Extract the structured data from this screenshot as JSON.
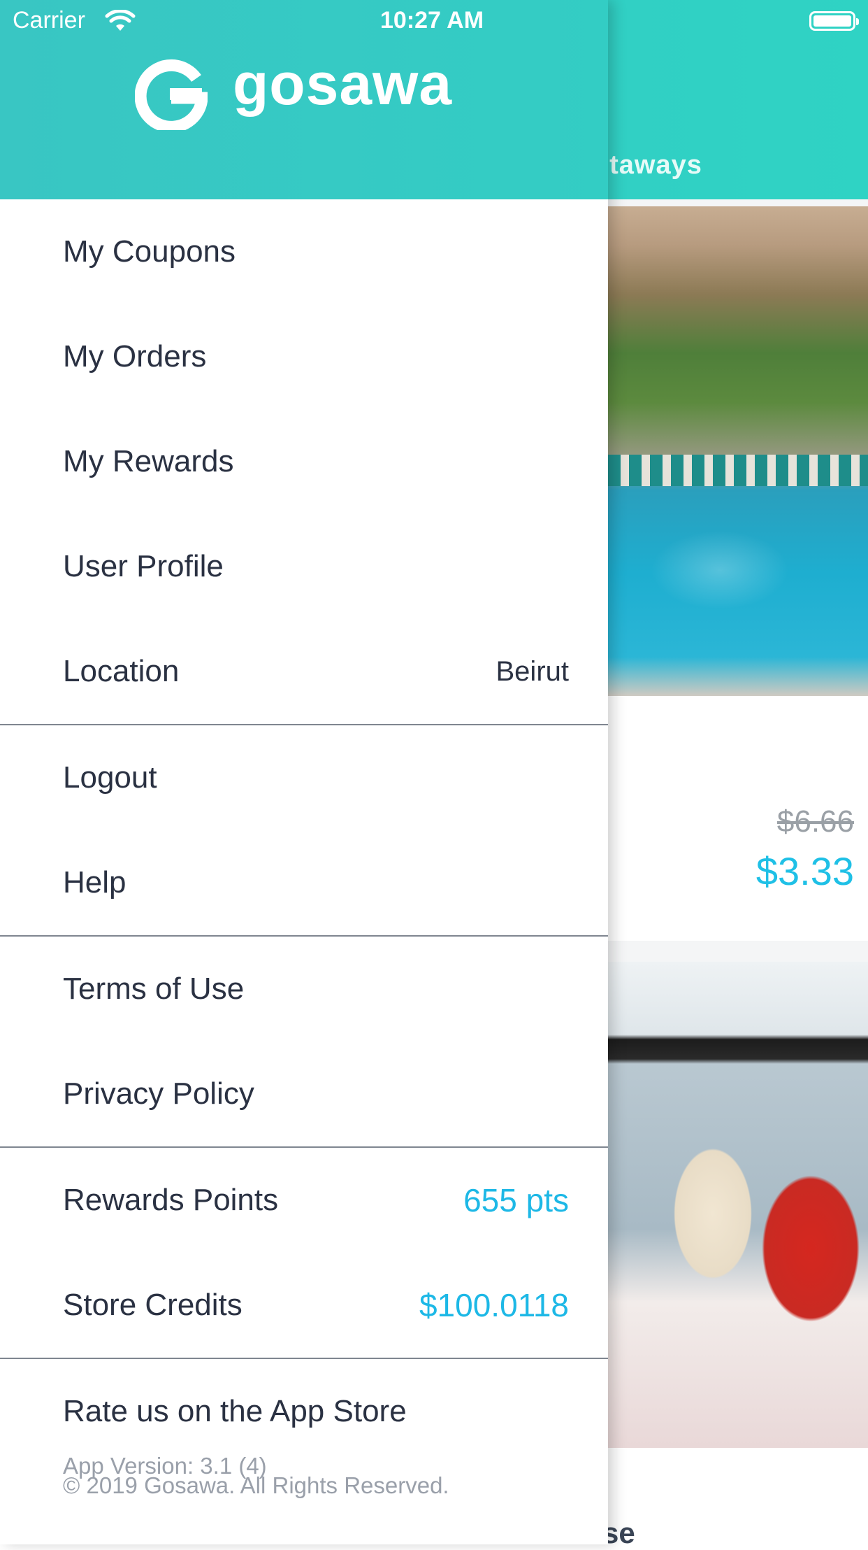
{
  "status_bar": {
    "carrier": "Carrier",
    "time": "10:27 AM"
  },
  "brand": {
    "name": "gosawa",
    "accent": "#33cdc4",
    "highlight": "#1db8e6"
  },
  "background": {
    "tab_label": "etaways",
    "price_old": "$6.66",
    "price_new": "$3.33",
    "bottom_text": "se"
  },
  "menu": {
    "coupons": "My Coupons",
    "orders": "My Orders",
    "rewards": "My Rewards",
    "profile": "User Profile",
    "location_label": "Location",
    "location_value": "Beirut",
    "logout": "Logout",
    "help": "Help",
    "terms": "Terms of Use",
    "privacy": "Privacy Policy",
    "points_label": "Rewards Points",
    "points_value": "655 pts",
    "credits_label": "Store Credits",
    "credits_value": "$100.0118"
  },
  "footer": {
    "rate": "Rate us on the App Store",
    "version": "App Version: 3.1 (4)",
    "copyright": "© 2019 Gosawa. All Rights Reserved."
  }
}
